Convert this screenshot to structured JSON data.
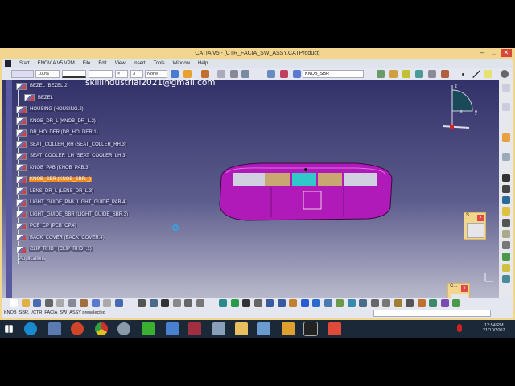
{
  "window": {
    "title": "CATIA V5 - [CTR_FACIA_SW_ASSY.CATProduct]",
    "minimize": "–",
    "maximize": "□",
    "close": "✕"
  },
  "menu": [
    "Start",
    "ENOVIA V5 VPM",
    "File",
    "Edit",
    "View",
    "Insert",
    "Tools",
    "Window",
    "Help"
  ],
  "toolbar": {
    "zoom": "100%",
    "layer": "None",
    "thickness": "3",
    "select_part": "KNOB_SBR"
  },
  "watermark": "skillindustrial2021@gmail.com",
  "tree": [
    {
      "label": "BEZEL (BEZEL.2)",
      "indent": 0
    },
    {
      "label": "BEZEL",
      "indent": 1
    },
    {
      "label": "HOUSING (HOUSING.2)",
      "indent": 0
    },
    {
      "label": "KNOB_DR_L (KNOB_DR_L.2)",
      "indent": 0
    },
    {
      "label": "DR_HOLDER (DR_HOLDER.1)",
      "indent": 0
    },
    {
      "label": "SEAT_COLLER_RH (SEAT_COLLER_RH.3)",
      "indent": 0
    },
    {
      "label": "SEAT_COOLER_LH (SEAT_COOLER_LH.3)",
      "indent": 0
    },
    {
      "label": "KNOB_PAB (KNOB_PAB.3)",
      "indent": 0
    },
    {
      "label": "KNOB_SBR (KNOB_SBR._)",
      "indent": 0,
      "highlighted": true
    },
    {
      "label": "LENS_DR_L (LENS_DR_L.3)",
      "indent": 0
    },
    {
      "label": "LIGHT_GUIDE_PAB (LIGHT_GUIDE_PAB.4)",
      "indent": 0
    },
    {
      "label": "LIGHT_GUIDE_SBR (LIGHT_GUIDE_SBR.3)",
      "indent": 0
    },
    {
      "label": "PCB_CP (PCB_CP.4)",
      "indent": 0
    },
    {
      "label": "BACK_COVER (BACK_COVER.4)",
      "indent": 0
    },
    {
      "label": "CLIP_RHD_ (CLIP_RHD_.1)",
      "indent": 0
    }
  ],
  "tree_root_footer": "Applications",
  "compass": {
    "z": "z",
    "y": "y",
    "x": "x"
  },
  "palettes": [
    {
      "title": "S..."
    },
    {
      "title": "C..."
    }
  ],
  "status": "KNOB_SBR._/CTR_FACIA_SW_ASSY preselected",
  "clock": {
    "time": "12:54 PM",
    "date": "21/10/2007"
  },
  "colors": {
    "highlight": "#f08a1c",
    "part": "#b01ab8",
    "frame": "#f3d68e"
  }
}
